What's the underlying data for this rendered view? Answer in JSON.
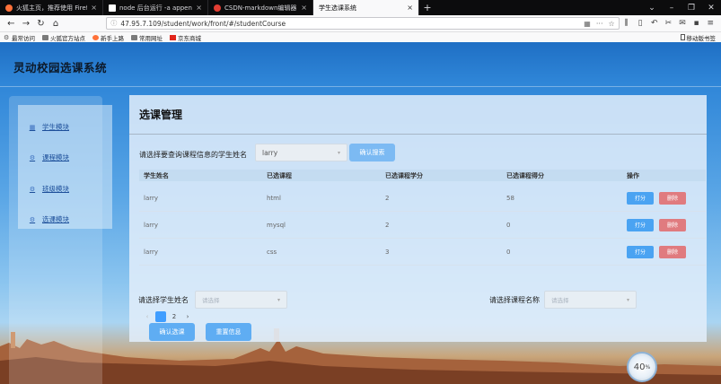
{
  "browser": {
    "tabs": [
      {
        "label": "火狐主页，推荐使用 Firefox 火",
        "icon": "firefox-icon",
        "color": "#ff7139",
        "active": false
      },
      {
        "label": "node 后台运行 -a append_日",
        "icon": "page-icon",
        "color": "#ffffff",
        "active": false
      },
      {
        "label": "CSDN-markdown编辑器",
        "icon": "csdn-icon",
        "color": "#e33e33",
        "active": false
      },
      {
        "label": "学生选课系统",
        "icon": "none",
        "color": "#f9f9fa",
        "active": true
      }
    ],
    "url": "47.95.7.109/student/work/front/#/studentCourse",
    "bookmarks": [
      {
        "label": "最常访问",
        "icon": "gear-icon"
      },
      {
        "label": "火狐官方站点",
        "icon": "folder-icon"
      },
      {
        "label": "新手上路",
        "icon": "firefox-icon"
      },
      {
        "label": "常用网址",
        "icon": "folder-icon"
      },
      {
        "label": "京东商城",
        "icon": "jd-icon"
      }
    ],
    "mobile_bookmarks": "移动版书签"
  },
  "app": {
    "title": "灵动校园选课系统",
    "menu": [
      {
        "label": "学生模块",
        "icon": "grid-icon"
      },
      {
        "label": "课程模块",
        "icon": "gear-icon"
      },
      {
        "label": "班级模块",
        "icon": "gear-icon"
      },
      {
        "label": "选课模块",
        "icon": "gear-icon"
      }
    ]
  },
  "panel": {
    "title": "选课管理",
    "search_label": "请选择要查询课程信息的学生姓名",
    "search_value": "larry",
    "search_button": "确认搜索",
    "table": {
      "headers": [
        "学生姓名",
        "已选课程",
        "已选课程学分",
        "已选课程得分",
        "操作"
      ],
      "rows": [
        {
          "name": "larry",
          "course": "html",
          "credit": "2",
          "score": "58"
        },
        {
          "name": "larry",
          "course": "mysql",
          "credit": "2",
          "score": "0"
        },
        {
          "name": "larry",
          "course": "css",
          "credit": "3",
          "score": "0"
        }
      ],
      "score_button": "打分",
      "delete_button": "删除"
    },
    "pager": {
      "prev": "‹",
      "pages": [
        "1",
        "2"
      ],
      "active_page": "1",
      "next": "›"
    }
  },
  "form": {
    "student_label": "请选择学生姓名",
    "student_placeholder": "请选择",
    "course_label": "请选择课程名称",
    "course_placeholder": "请选择",
    "confirm_button": "确认选课",
    "reset_button": "重置信息"
  },
  "widget": {
    "value": "40",
    "unit": "%"
  }
}
